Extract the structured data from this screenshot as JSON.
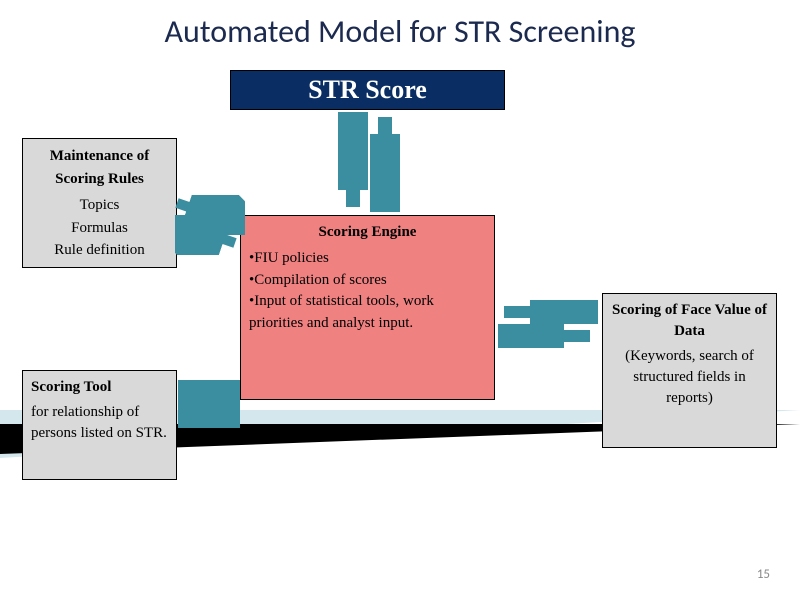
{
  "slide": {
    "title": "Automated Model for STR Screening",
    "page_number": "15"
  },
  "str_score": {
    "label": "STR Score"
  },
  "maintenance": {
    "title": "Maintenance of Scoring Rules",
    "line1": "Topics",
    "line2": "Formulas",
    "line3": "Rule definition"
  },
  "engine": {
    "title": "Scoring Engine",
    "bullet1": "FIU policies",
    "bullet2": "Compilation of scores",
    "bullet3": "Input of statistical tools, work  priorities and analyst input."
  },
  "tool": {
    "title": "Scoring Tool",
    "body": "for relationship of persons listed on STR."
  },
  "face": {
    "title": "Scoring of Face Value of Data",
    "body": "(Keywords, search of structured fields in reports)"
  },
  "colors": {
    "arrow": "#3b8ea0"
  }
}
